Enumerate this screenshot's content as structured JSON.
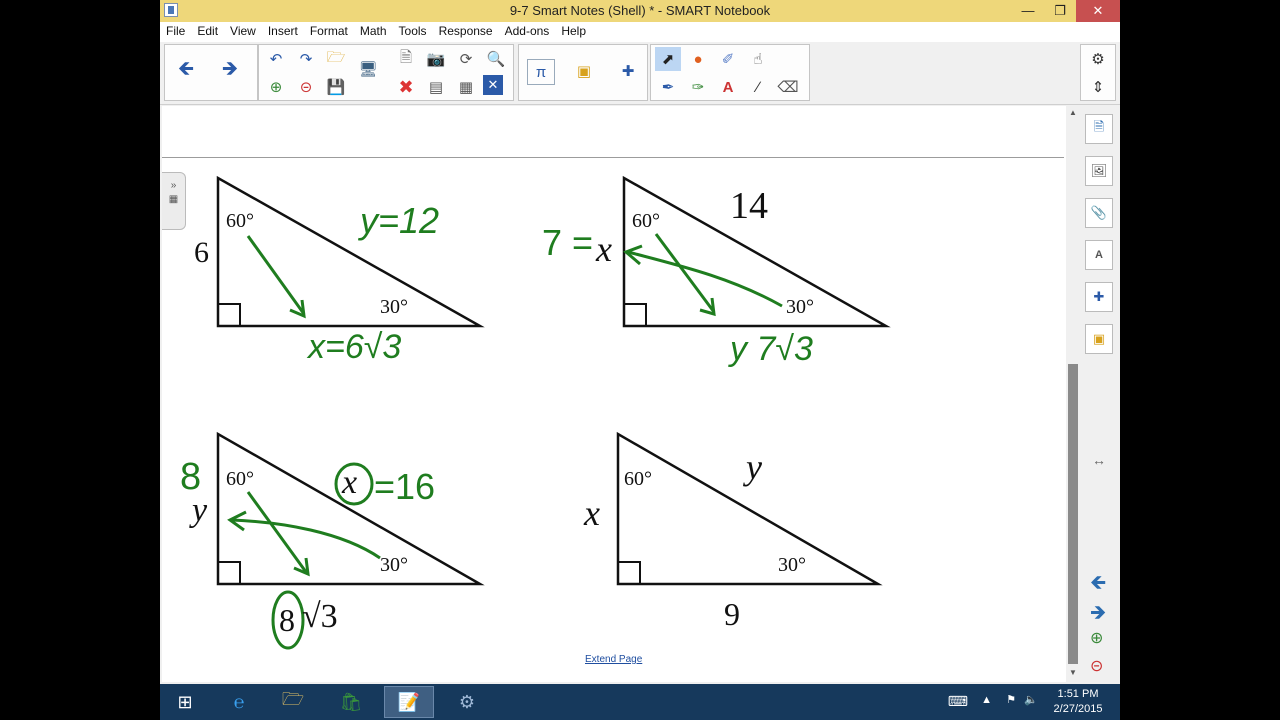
{
  "window": {
    "title": "9-7 Smart Notes (Shell) * - SMART Notebook"
  },
  "menu": [
    "File",
    "Edit",
    "View",
    "Insert",
    "Format",
    "Math",
    "Tools",
    "Response",
    "Add-ons",
    "Help"
  ],
  "page": {
    "extend_link": "Extend Page"
  },
  "problems": [
    {
      "left_side": "6",
      "angle_top": "60°",
      "angle_bottom": "30°",
      "hyp_answer": "y=12",
      "base_answer": "x=6√3"
    },
    {
      "top_label": "14",
      "angle_top": "60°",
      "angle_bottom": "30°",
      "left_answer": "7 = ",
      "left_var": "x",
      "base_answer": "y 7√3"
    },
    {
      "left_answer": "8",
      "left_var": "y",
      "angle_top": "60°",
      "angle_bottom": "30°",
      "hyp_var": "x",
      "hyp_answer": "=16",
      "base_circled": "8",
      "base_radical": "√3"
    },
    {
      "left_var": "x",
      "hyp_var": "y",
      "angle_top": "60°",
      "angle_bottom": "30°",
      "base": "9"
    }
  ],
  "taskbar": {
    "time": "1:51 PM",
    "date": "2/27/2015"
  },
  "colors": {
    "title_bar": "#eed77a",
    "ink": "#1f7d1f",
    "taskbar": "#16395c"
  }
}
